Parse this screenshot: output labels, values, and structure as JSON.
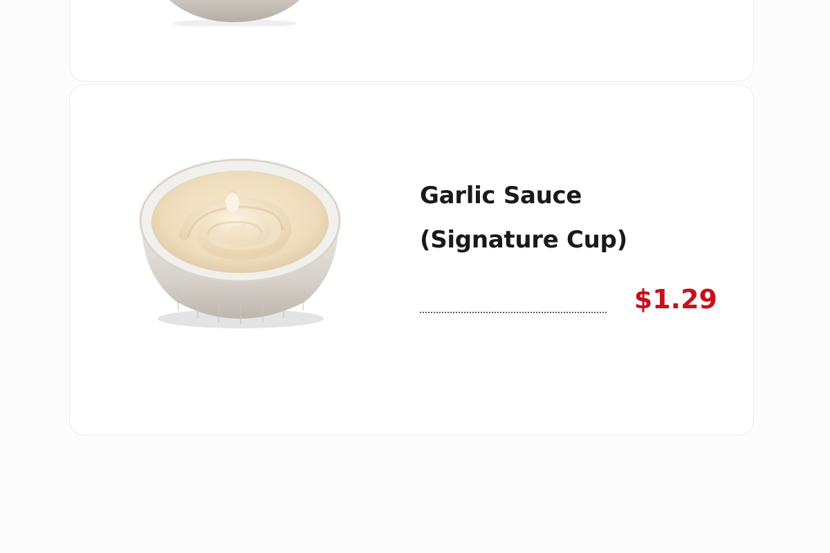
{
  "colors": {
    "price": "#c8101c",
    "name_text": "#1a1a1a",
    "card_background": "#ffffff",
    "page_background": "#fcfcfc"
  },
  "menu": {
    "items": [
      {
        "name": "",
        "image_icon": "sauce-bowl-icon"
      },
      {
        "name_line1": "Garlic Sauce",
        "name_line2": "(Signature Cup)",
        "price": "$1.29",
        "image_icon": "garlic-sauce-cup-icon"
      }
    ]
  }
}
